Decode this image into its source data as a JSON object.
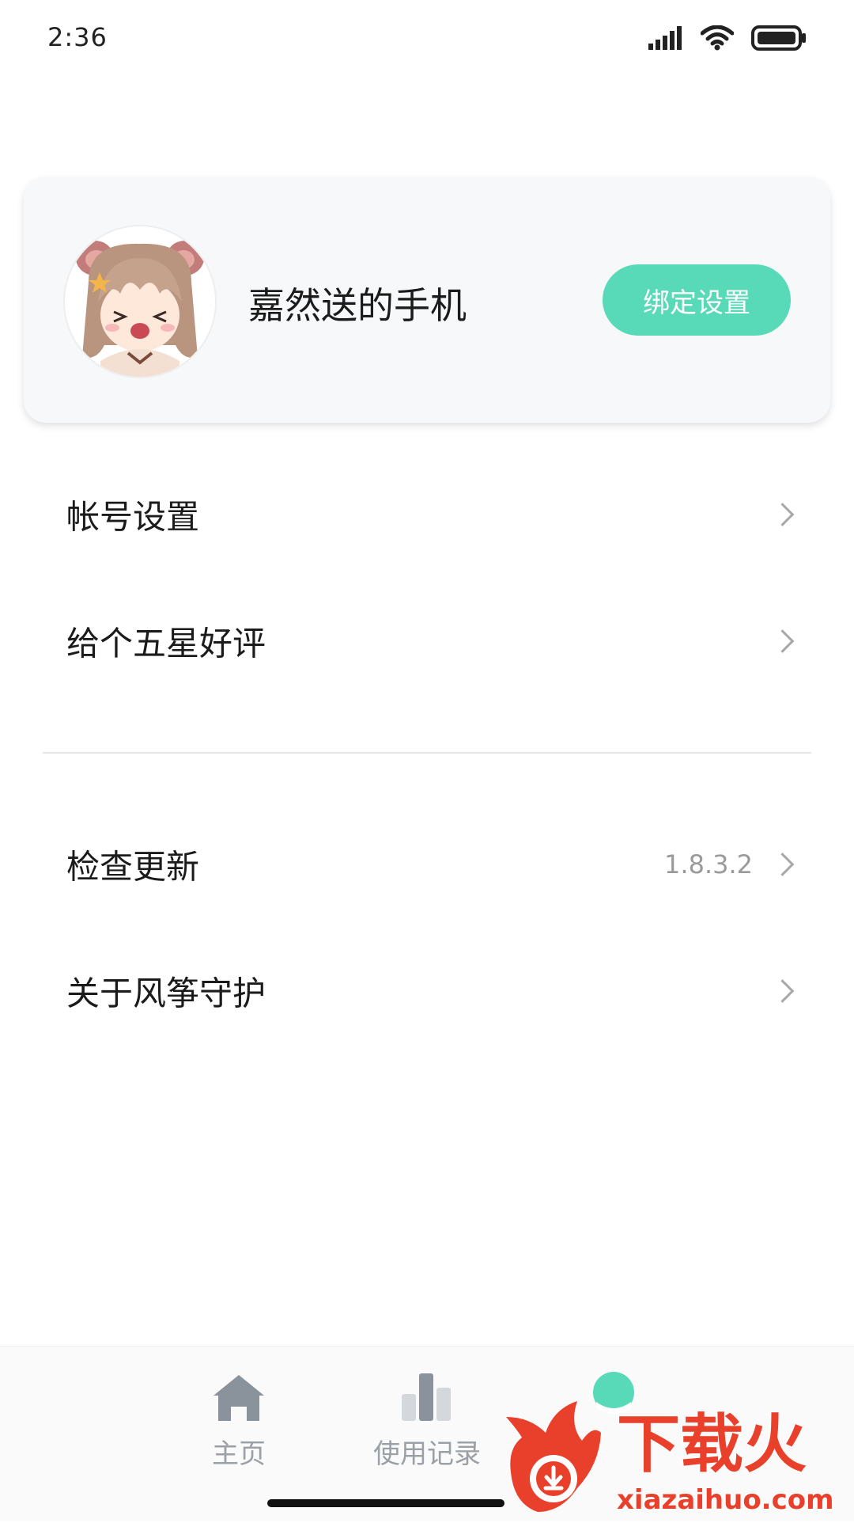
{
  "status_bar": {
    "time": "2:36",
    "icons": [
      "signal-icon",
      "wifi-icon",
      "battery-icon"
    ]
  },
  "profile": {
    "device_name": "嘉然送的手机",
    "bind_button_label": "绑定设置",
    "accent_color": "#58d9b7"
  },
  "menu": {
    "account_settings": "帐号设置",
    "rate_five_stars": "给个五星好评",
    "check_update": "检查更新",
    "version": "1.8.3.2",
    "about": "关于风筝守护"
  },
  "bottom_nav": {
    "tabs": [
      {
        "label": "主页",
        "icon": "home-icon"
      },
      {
        "label": "使用记录",
        "icon": "bar-chart-icon"
      },
      {
        "label": "",
        "icon": "profile-icon"
      }
    ]
  },
  "watermark": {
    "text": "下载火",
    "url": "xiazaihuo.com"
  }
}
